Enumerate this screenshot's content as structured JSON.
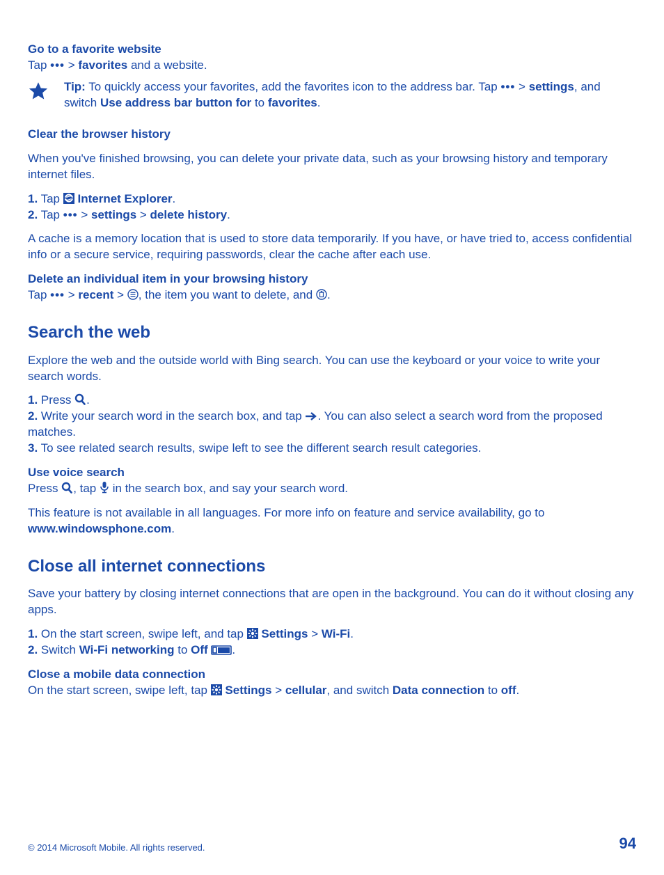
{
  "s1": {
    "heading": "Go to a favorite website",
    "line1_a": "Tap ",
    "line1_b": " > ",
    "favorites": "favorites",
    "line1_c": " and a website.",
    "tip_label": "Tip:",
    "tip_a": " To quickly access your favorites, add the favorites icon to the address bar. Tap ",
    "tip_b": " > ",
    "settings": "settings",
    "tip_c": ", and switch ",
    "use_addr": "Use address bar button for",
    "tip_d": " to ",
    "fav2": "favorites",
    "tip_e": "."
  },
  "s2": {
    "heading": "Clear the browser history",
    "p1": "When you've finished browsing, you can delete your private data, such as your browsing history and temporary internet files.",
    "step1_a": "1.",
    "step1_b": " Tap ",
    "ie": "Internet Explorer",
    "step1_c": ".",
    "step2_a": "2.",
    "step2_b": " Tap ",
    "settings": "settings",
    "gt": " > ",
    "delhist": "delete history",
    "period": ".",
    "p2": "A cache is a memory location that is used to store data temporarily. If you have, or have tried to, access confidential info or a secure service, requiring passwords, clear the cache after each use.",
    "sub2": "Delete an individual item in your browsing history",
    "d_a": "Tap ",
    "d_b": " > ",
    "recent": "recent",
    "d_c": " > ",
    "d_d": ", the item you want to delete, and ",
    "d_e": "."
  },
  "s3": {
    "heading": "Search the web",
    "p1": "Explore the web and the outside world with Bing search. You can use the keyboard or your voice to write your search words.",
    "st1a": "1.",
    "st1b": " Press ",
    "st1c": ".",
    "st2a": "2.",
    "st2b": " Write your search word in the search box, and tap ",
    "st2c": ". You can also select a search word from the proposed matches.",
    "st3a": "3.",
    "st3b": " To see related search results, swipe left to see the different search result categories.",
    "sub": "Use voice search",
    "v_a": "Press ",
    "v_b": ", tap ",
    "v_c": " in the search box, and say your search word.",
    "p2a": "This feature is not available in all languages. For more info on feature and service availability, go to ",
    "url": "www.windowsphone.com",
    "p2b": "."
  },
  "s4": {
    "heading": "Close all internet connections",
    "p1": "Save your battery by closing internet connections that are open in the background. You can do it without closing any apps.",
    "st1a": "1.",
    "st1b": " On the start screen, swipe left, and tap ",
    "settings": "Settings",
    "gt": " > ",
    "wifi": "Wi-Fi",
    "period": ".",
    "st2a": "2.",
    "st2b": " Switch ",
    "wfn": "Wi-Fi networking",
    "st2c": " to ",
    "off": "Off",
    "sp": " ",
    "sub": "Close a mobile data connection",
    "m_a": "On the start screen, swipe left, tap ",
    "m_b": " > ",
    "cellular": "cellular",
    "m_c": ", and switch ",
    "dc": "Data connection",
    "m_d": " to ",
    "off2": "off",
    "m_e": "."
  },
  "footer": {
    "copyright": "© 2014 Microsoft Mobile. All rights reserved.",
    "page": "94"
  },
  "dots": "•••"
}
